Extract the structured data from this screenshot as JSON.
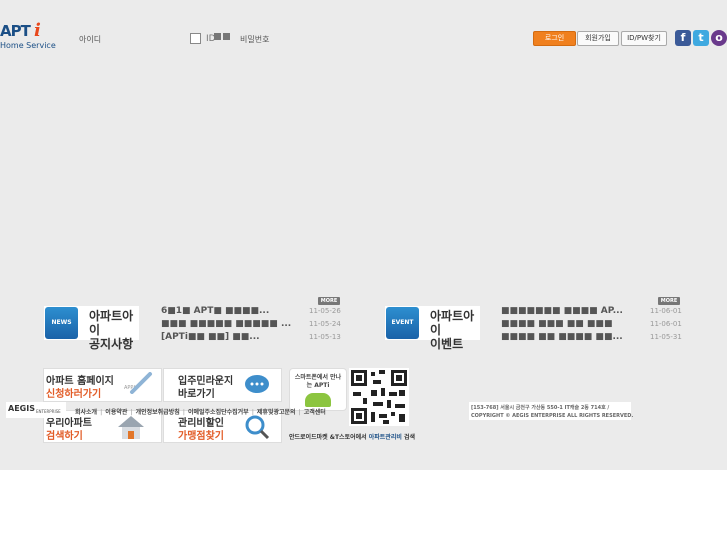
{
  "brand": {
    "logo_main": "APT",
    "logo_i": "i",
    "logo_sub": "Home Service"
  },
  "login": {
    "id_label": "아이디",
    "save_id_prefix": "ID",
    "pw_label": "비밀번호",
    "login_button": "로그인",
    "join_button": "회원가입",
    "find_button": "ID/PW찾기"
  },
  "social": {
    "facebook": "f",
    "twitter": "t",
    "other": "o"
  },
  "notice": {
    "badge": "NEWS",
    "title_line1": "아파트아이",
    "title_line2": "공지사항",
    "more": "MORE",
    "items": [
      {
        "title": "6■1■ APT■ ■■■■...",
        "date": "11-05-26"
      },
      {
        "title": "■■■ ■■■■■ ■■■■■ ...",
        "date": "11-05-24"
      },
      {
        "title": "[APTi■■ ■■] ■■...",
        "date": "11-05-13"
      }
    ]
  },
  "event": {
    "badge": "EVENT",
    "title_line1": "아파트아이",
    "title_line2": "이벤트",
    "more": "MORE",
    "items": [
      {
        "title": "■■■■■■■ ■■■■ AP...",
        "date": "11-06-01"
      },
      {
        "title": "■■■■ ■■■ ■■ ■■■",
        "date": "11-06-01"
      },
      {
        "title": "■■■■ ■■ ■■■■ ■■...",
        "date": "11-05-31"
      }
    ]
  },
  "banners": {
    "homepage_l1": "아파트 홈페이지",
    "homepage_l2": "신청하러가기",
    "homepage_tag": "APPLY",
    "community_l1": "입주민라운지",
    "community_l2": "바로가기",
    "search_l1": "우리아파트",
    "search_l2": "검색하기",
    "discount_l1": "관리비할인",
    "discount_l2": "가맹점찾기",
    "app_text": "스마트폰에서 만나는 APTi",
    "app_caption_prefix": "안드로이드마켓 &T스토어에서 ",
    "app_caption_strong": "아파트관리비",
    "app_caption_suffix": " 검색"
  },
  "footer": {
    "logo": "AEGIS",
    "logo_sub": "ENTERPRISE",
    "links": [
      "회사소개",
      "이용약관",
      "개인정보취급방침",
      "이메일주소집단수집거부",
      "제휴및광고문의",
      "고객센터"
    ],
    "address": "[153-768] 서울시 금천구 가산동 550-1 IT캐슬 2동 714호 /",
    "copyright": "COPYRIGHT © AEGIS ENTERPRISE ALL RIGHTS RESERVED."
  }
}
